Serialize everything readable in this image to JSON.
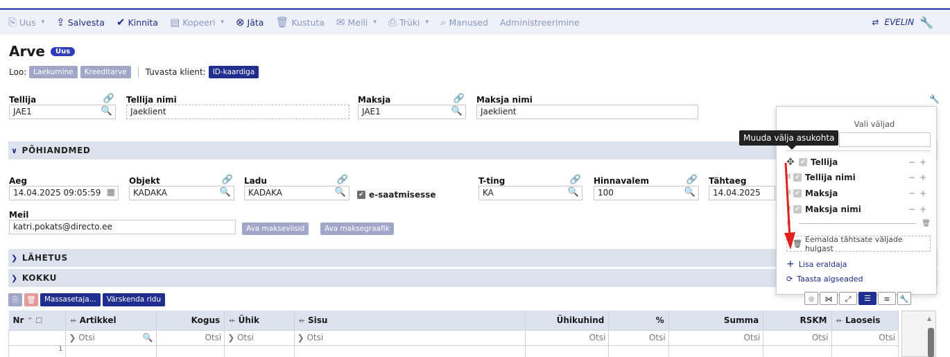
{
  "toolbar": {
    "new": "Uus",
    "save": "Salvesta",
    "confirm": "Kinnita",
    "copy": "Kopeeri",
    "leave": "Jäta",
    "delete": "Kustuta",
    "mail": "Meili",
    "print": "Trüki",
    "attachments": "Manused",
    "admin": "Administreerimine",
    "user": "EVELIN"
  },
  "title": "Arve",
  "title_badge": "Uus",
  "loo": {
    "label": "Loo:",
    "b1": "Laekumine",
    "b2": "Kreeditarve",
    "verify_label": "Tuvasta klient:",
    "b3": "ID-kaardiga"
  },
  "fields": {
    "tellija": {
      "label": "Tellija",
      "value": "JAE1"
    },
    "tellija_nimi": {
      "label": "Tellija nimi",
      "value": "Jaeklient"
    },
    "maksja": {
      "label": "Maksja",
      "value": "JAE1"
    },
    "maksja_nimi": {
      "label": "Maksja nimi",
      "value": "Jaeklient"
    },
    "aeg": {
      "label": "Aeg",
      "value": "14.04.2025 09:05:59"
    },
    "objekt": {
      "label": "Objekt",
      "value": "KADAKA"
    },
    "ladu": {
      "label": "Ladu",
      "value": "KADAKA"
    },
    "esaat": {
      "label": "e-saatmisesse"
    },
    "tting": {
      "label": "T-ting",
      "value": "KA"
    },
    "hinnavalem": {
      "label": "Hinnavalem",
      "value": "100"
    },
    "tahtaeg": {
      "label": "Tähtaeg",
      "value": "14.04.2025"
    },
    "meil": {
      "label": "Meil",
      "value": "katri.pokats@directo.ee"
    }
  },
  "buttons": {
    "ava_makseviisid": "Ava makseviisid",
    "ava_maksegraafik": "Ava maksegraafik",
    "massasetaja": "Massasetaja...",
    "varskenda": "Värskenda ridu"
  },
  "sections": {
    "pohiandmed": "PÕHIANDMED",
    "lahetus": "LÄHETUS",
    "kokku": "KOKKU"
  },
  "grid": {
    "headers": [
      "Nr",
      "Artikkel",
      "Kogus",
      "Ühik",
      "Sisu",
      "Ühikuhind",
      "%",
      "Summa",
      "RSKM",
      "Laoseis"
    ],
    "search": "Otsi",
    "row_nr": "1"
  },
  "popup": {
    "title": "Vali väljad",
    "tooltip": "Muuda välja asukohta",
    "items": [
      "Tellija",
      "Tellija nimi",
      "Maksja",
      "Maksja nimi"
    ],
    "remove": "Eemalda tähtsate väljade hulgast",
    "add_sep": "Lisa eraldaja",
    "reset": "Taasta algseaded"
  },
  "colors": {
    "navy": "#1f2e8f",
    "section_bg": "#dde3ee",
    "arrow": "#e0201c"
  }
}
